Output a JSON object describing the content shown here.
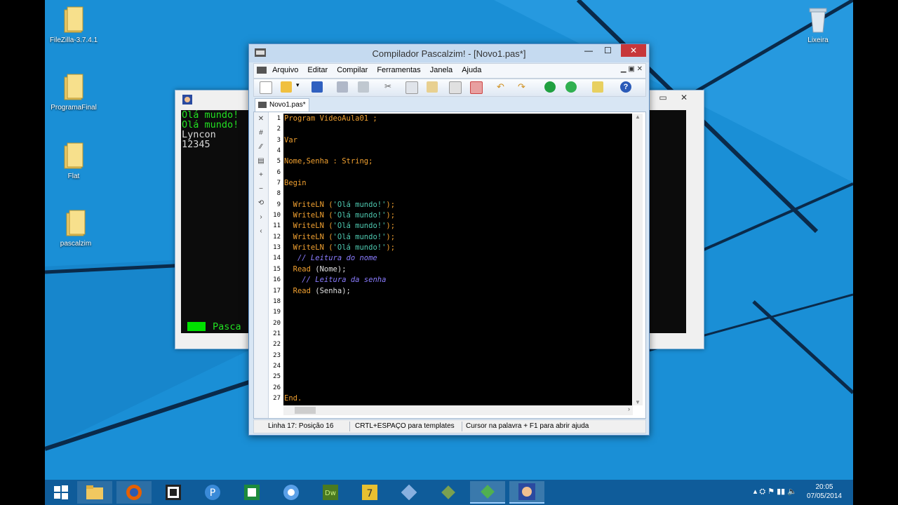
{
  "desktop": {
    "icons": [
      {
        "label": "FileZilla-3.7.4.1",
        "icon": "folder-icon"
      },
      {
        "label": "ProgramaFinal",
        "icon": "folder-icon"
      },
      {
        "label": "Flat",
        "icon": "folder-icon"
      },
      {
        "label": "pascalzim",
        "icon": "folder-icon"
      },
      {
        "label": "Lixeira",
        "icon": "recycle-bin-icon"
      }
    ]
  },
  "console_window": {
    "lines": [
      "Olá mundo!",
      "Olá mundo!",
      "Lyncon",
      "12345"
    ],
    "status_text": "Pasca"
  },
  "ide": {
    "title": "Compilador Pascalzim! - [Novo1.pas*]",
    "menu": [
      "Arquivo",
      "Editar",
      "Compilar",
      "Ferramentas",
      "Janela",
      "Ajuda"
    ],
    "tab_label": "Novo1.pas*",
    "line_numbers": [
      "1",
      "2",
      "3",
      "4",
      "5",
      "6",
      "7",
      "8",
      "9",
      "10",
      "11",
      "12",
      "13",
      "14",
      "15",
      "16",
      "17",
      "18",
      "19",
      "20",
      "21",
      "22",
      "23",
      "24",
      "25",
      "26",
      "27"
    ],
    "status": {
      "position": "Linha 17: Posição 16",
      "templates": "CRTL+ESPAÇO para templates",
      "help": "Cursor na palavra + F1 para abrir ajuda"
    }
  },
  "code_lines": [
    {
      "pre": "Program VideoAula01 ;",
      "str": "",
      "post": "",
      "type": "plain"
    },
    {
      "pre": "",
      "str": "",
      "post": "",
      "type": "plain"
    },
    {
      "pre": "Var",
      "str": "",
      "post": "",
      "type": "plain"
    },
    {
      "pre": "",
      "str": "",
      "post": "",
      "type": "plain"
    },
    {
      "pre": "Nome,Senha : ",
      "str": "",
      "post": "String;",
      "type": "decl"
    },
    {
      "pre": "",
      "str": "",
      "post": "",
      "type": "plain"
    },
    {
      "pre": "Begin",
      "str": "",
      "post": "",
      "type": "plain"
    },
    {
      "pre": "",
      "str": "",
      "post": "",
      "type": "plain"
    },
    {
      "pre": "  WriteLN (",
      "str": "'Olá mundo!'",
      "post": ");",
      "type": "write"
    },
    {
      "pre": "  WriteLN (",
      "str": "'Olá mundo!'",
      "post": ");",
      "type": "write"
    },
    {
      "pre": "  WriteLN (",
      "str": "'Olá mundo!'",
      "post": ");",
      "type": "write"
    },
    {
      "pre": "  WriteLN (",
      "str": "'Olá mundo!'",
      "post": ");",
      "type": "write"
    },
    {
      "pre": "  WriteLN (",
      "str": "'Olá mundo!'",
      "post": ");",
      "type": "write"
    },
    {
      "pre": "   ",
      "str": "// Leitura do nome",
      "post": "",
      "type": "comment"
    },
    {
      "pre": "  Read ",
      "str": "(Nome);",
      "post": "",
      "type": "read"
    },
    {
      "pre": "    ",
      "str": "// Leitura da senha",
      "post": "",
      "type": "comment"
    },
    {
      "pre": "  Read ",
      "str": "(Senha);",
      "post": "",
      "type": "read"
    },
    {
      "pre": "",
      "str": "",
      "post": "",
      "type": "plain"
    },
    {
      "pre": "",
      "str": "",
      "post": "",
      "type": "plain"
    },
    {
      "pre": "",
      "str": "",
      "post": "",
      "type": "plain"
    },
    {
      "pre": "",
      "str": "",
      "post": "",
      "type": "plain"
    },
    {
      "pre": "",
      "str": "",
      "post": "",
      "type": "plain"
    },
    {
      "pre": "",
      "str": "",
      "post": "",
      "type": "plain"
    },
    {
      "pre": "",
      "str": "",
      "post": "",
      "type": "plain"
    },
    {
      "pre": "",
      "str": "",
      "post": "",
      "type": "plain"
    },
    {
      "pre": "",
      "str": "",
      "post": "",
      "type": "plain"
    },
    {
      "pre": "End.",
      "str": "",
      "post": "",
      "type": "plain"
    }
  ],
  "taskbar": {
    "apps": [
      "start-icon",
      "file-explorer-icon",
      "firefox-icon",
      "video-editor-icon",
      "pacote-p-icon",
      "excel-icon",
      "itunes-icon",
      "dreamweaver-icon",
      "7zip-icon",
      "virtualbox-icon",
      "pascal-tool-icon",
      "pascalzim-green-icon",
      "pascalzim-console-icon"
    ],
    "time": "20:05",
    "date": "07/05/2014"
  },
  "colors": {
    "desktop": "#1a8fd6",
    "code_bg": "#000000",
    "keyword": "#f0a030",
    "string": "#4ec9b0",
    "comment": "#8a7cff"
  }
}
